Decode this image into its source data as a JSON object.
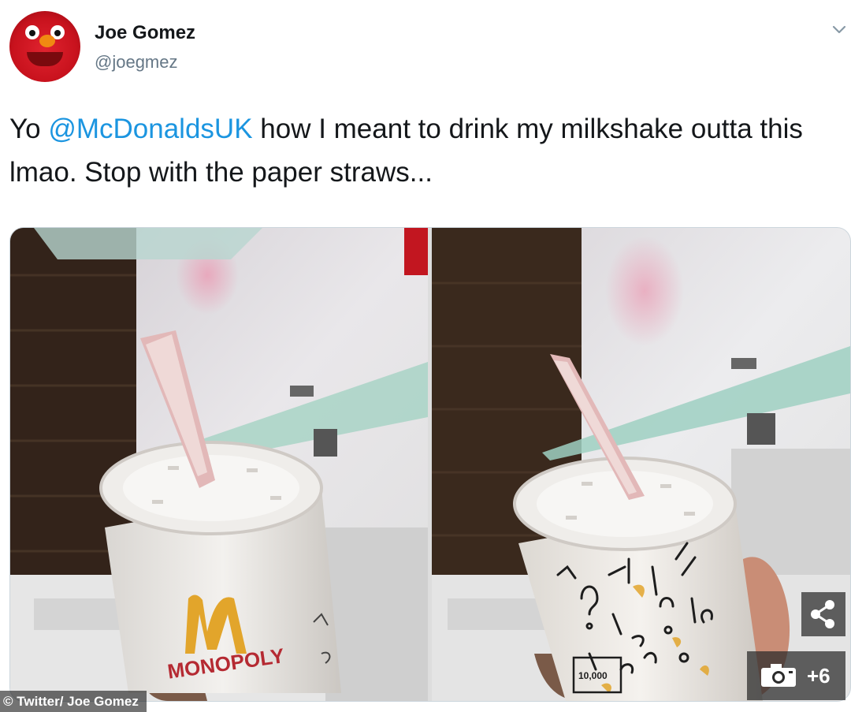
{
  "tweet": {
    "author_name": "Joe Gomez",
    "author_handle": "@joegmez",
    "text_prefix": "Yo ",
    "mention": "@McDonaldsUK",
    "text_suffix": " how I meant to drink my milkshake outta this lmao. Stop with the paper straws..."
  },
  "media": {
    "left_cup_brand": "MONOPOLY",
    "right_cup_print": "10,000",
    "credit": "© Twitter/ Joe Gomez",
    "more_photos_count": "+6"
  },
  "icons": [
    "chevron-down-icon",
    "share-icon",
    "camera-icon"
  ],
  "colors": {
    "mention": "#1b95e0",
    "name": "#14171a",
    "handle": "#657786"
  }
}
